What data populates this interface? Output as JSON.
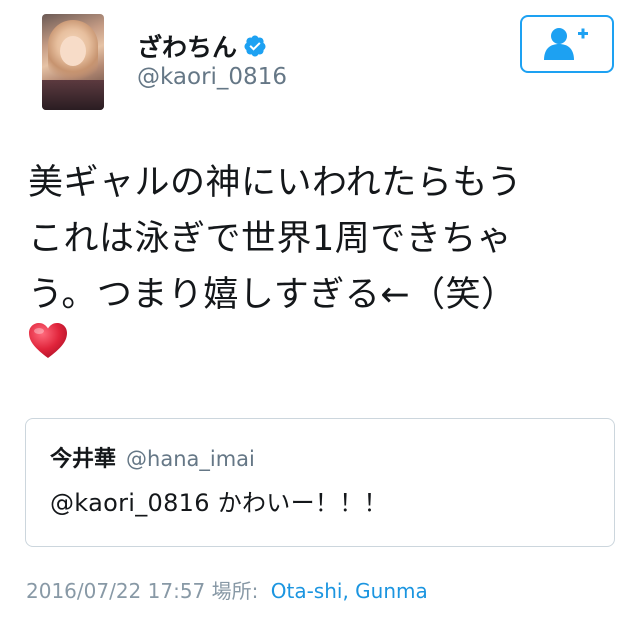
{
  "profile": {
    "display_name": "ざわちん",
    "handle": "@kaori_0816",
    "verified_icon": "verified-badge-icon"
  },
  "follow_button": {
    "icon": "add-user-icon"
  },
  "tweet": {
    "lines": [
      "美ギャルの神にいわれたらもう",
      "これは泳ぎで世界1周できちゃ",
      "う。つまり嬉しすぎる←（笑）"
    ],
    "emoji": "red-heart-icon"
  },
  "quoted_tweet": {
    "name": "今井華",
    "handle": "@hana_imai",
    "text": "@kaori_0816 かわいー！！！"
  },
  "meta": {
    "datetime": "2016/07/22 17:57",
    "location_label": "場所:",
    "location": "Ota-shi, Gunma"
  },
  "colors": {
    "accent": "#1da1f2",
    "secondary_text": "#657786",
    "border": "#ccd6dd",
    "heart": "#e0245e"
  }
}
